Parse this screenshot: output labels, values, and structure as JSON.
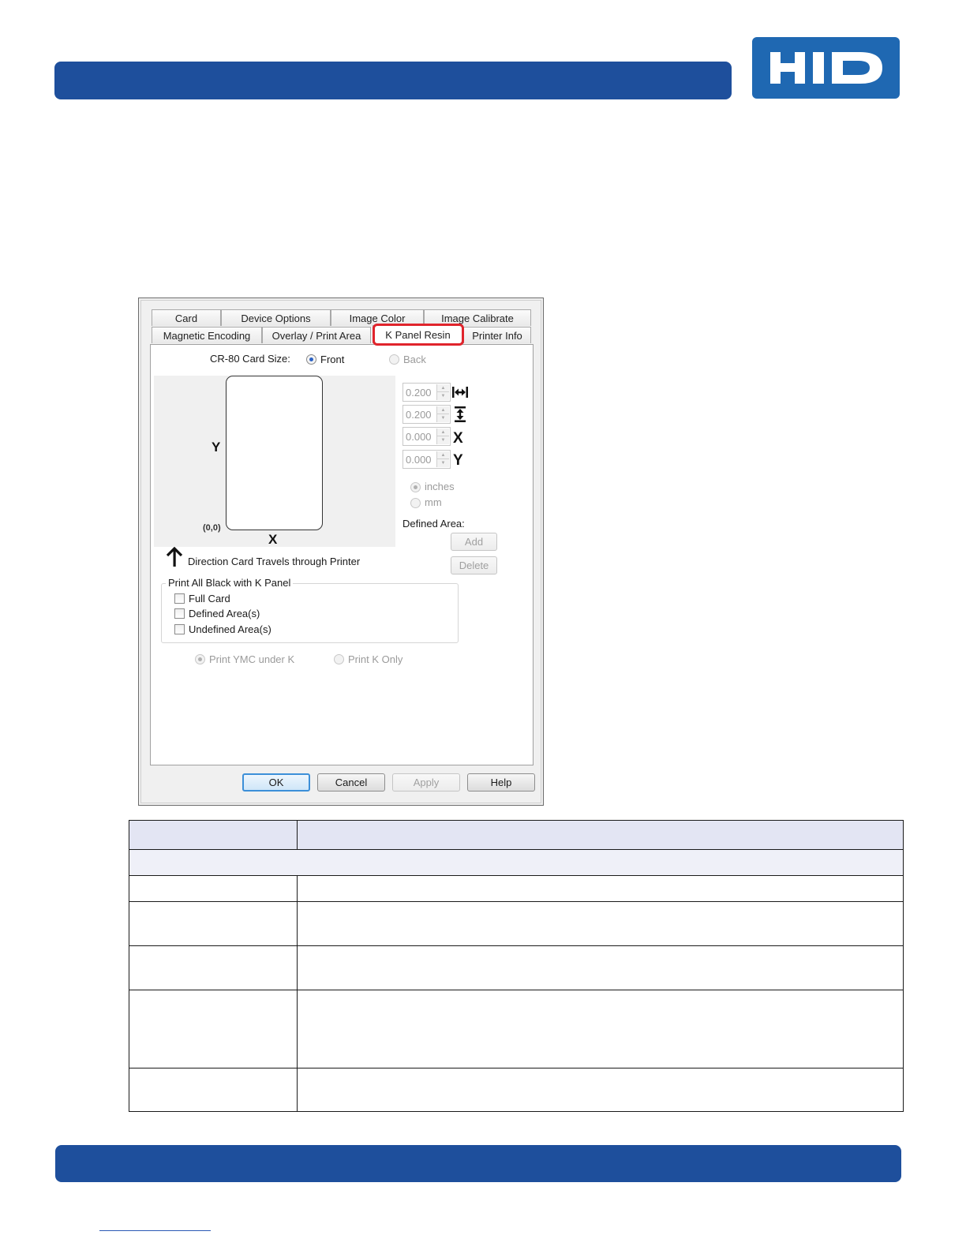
{
  "header": {
    "logo_text": "HID",
    "logo_color": "#1f68b2",
    "bar_color": "#1e4f9c"
  },
  "dialog": {
    "tabs_row1": [
      "Card",
      "Device Options",
      "Image Color",
      "Image Calibrate"
    ],
    "tabs_row2": [
      "Magnetic Encoding",
      "Overlay / Print Area",
      "K Panel Resin",
      "Printer Info"
    ],
    "active_tab": "K Panel Resin",
    "card_size_label": "CR-80 Card Size:",
    "side_front": "Front",
    "side_back": "Back",
    "preview": {
      "y_label": "Y",
      "x_label": "X",
      "origin_label": "(0,0)"
    },
    "spinners": [
      {
        "value": "0.200",
        "icon": "width-icon",
        "glyph": "↔"
      },
      {
        "value": "0.200",
        "icon": "height-icon",
        "glyph": "↕"
      },
      {
        "value": "0.000",
        "icon": "x-offset-icon",
        "glyph": "X"
      },
      {
        "value": "0.000",
        "icon": "y-offset-icon",
        "glyph": "Y"
      }
    ],
    "units_inches": "inches",
    "units_mm": "mm",
    "defined_area_label": "Defined Area:",
    "add_label": "Add",
    "delete_label": "Delete",
    "direction_text": "Direction Card Travels through Printer",
    "group_label": "Print All Black with K Panel",
    "checkbox_full_card": "Full Card",
    "checkbox_defined": "Defined Area(s)",
    "checkbox_undefined": "Undefined Area(s)",
    "option_ymc_under_k": "Print YMC under K",
    "option_k_only": "Print K Only",
    "ok_label": "OK",
    "cancel_label": "Cancel",
    "apply_label": "Apply",
    "help_label": "Help"
  },
  "table": {
    "header_bg": "#e3e5f3",
    "subheader_bg": "#eff0f8"
  }
}
